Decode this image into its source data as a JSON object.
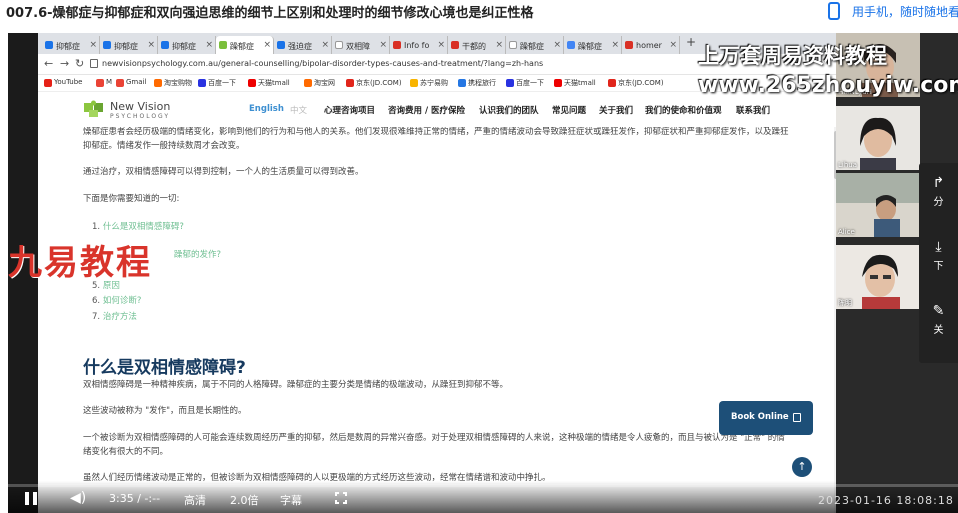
{
  "page": {
    "title": "007.6-燥郁症与抑郁症和双向强迫思维的细节上区别和处理时的细节修改心境也是纠正性格",
    "phone_text": "用手机，随时随地看"
  },
  "browser": {
    "tabs": [
      "抑郁症",
      "抑郁症",
      "抑郁症",
      "躁郁症",
      "强迫症",
      "双相障",
      "Info fo",
      "干都的",
      "躁郁症",
      "躁郁症",
      "homer"
    ],
    "url": "newvisionpsychology.com.au/general-counselling/bipolar-disorder-types-causes-and-treatment/?lang=zh-hans",
    "bookmarks": [
      "YouTube",
      "M",
      "Gmail",
      "淘宝购物",
      "百度一下",
      "天猫tmall",
      "淘宝网",
      "京东(JD.COM)",
      "苏宁易购",
      "携程旅行",
      "百度一下",
      "天猫tmall",
      "京东(JD.COM)"
    ]
  },
  "site": {
    "logo_line1": "New Vision",
    "logo_line2": "PSYCHOLOGY",
    "nav": [
      "English",
      "中文",
      "心理咨询项目",
      "咨询费用 / 医疗保险",
      "认识我们的团队",
      "常见问题",
      "关于我们",
      "我们的使命和价值观",
      "联系我们"
    ]
  },
  "article": {
    "p1": "燥郁症患者会经历极端的情绪变化，影响到他们的行为和与他人的关系。他们发现很难维持正常的情绪，严重的情绪波动会导致躁狂症状或躁狂发作，抑郁症状和严重抑郁症发作，以及躁狂抑郁症。情绪发作一般持续数周才会改变。",
    "p2": "通过治疗，双相情感障碍可以得到控制，一个人的生活质量可以得到改善。",
    "p3": "下面是你需要知道的一切:",
    "list": [
      {
        "num": "1.",
        "text": "什么是双相情感障碍?"
      },
      {
        "num": "",
        "text": "躁郁的发作?"
      },
      {
        "num": "5.",
        "text": "原因"
      },
      {
        "num": "6.",
        "text": "如何诊断?"
      },
      {
        "num": "7.",
        "text": "治疗方法"
      }
    ],
    "heading": "什么是双相情感障碍?",
    "p4": "双相情感障碍是一种精神疾病，属于不同的人格障碍。躁郁症的主要分类是情绪的极端波动，从躁狂到抑郁不等。",
    "p5": "这些波动被称为 \"发作\"，而且是长期性的。",
    "p6": "一个被诊断为双相情感障碍的人可能会连续数周经历严重的抑郁，然后是数周的异常兴奋感。对于处理双相情感障碍的人来说，这种极端的情绪是令人疲惫的，而且与被认为是 \"正常\" 的情绪变化有很大的不同。",
    "p7": "虽然人们经历情绪波动是正常的，但被诊断为双相情感障碍的人以更极端的方式经历这些波动，经常在情绪谱和波动中挣扎。",
    "book_online": "Book Online"
  },
  "watermarks": {
    "left": "九易教程",
    "top": "上万套周易资料教程",
    "url": "www.265zhouyiw.com"
  },
  "participants": [
    "HinNLyaH",
    "Lihua",
    "Alice",
    "陈明"
  ],
  "side_panel": [
    "分",
    "下",
    "关"
  ],
  "player": {
    "current_time": "3:35",
    "separator": "/",
    "duration": "-:--",
    "quality": "高清",
    "speed": "2.0倍",
    "subtitle": "字幕",
    "timestamp": "2023-01-16  18:08:18"
  }
}
